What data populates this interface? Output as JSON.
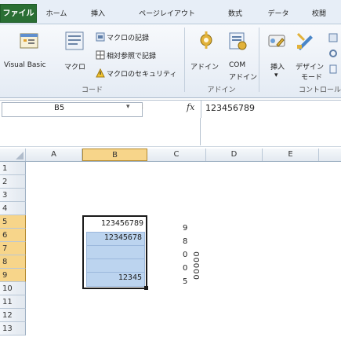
{
  "ribbon": {
    "tabs": [
      "ファイル",
      "ホーム",
      "挿入",
      "ページレイアウト",
      "数式",
      "データ",
      "校閲"
    ],
    "groups": {
      "code": {
        "label": "コード",
        "visual_basic": "Visual Basic",
        "macro": "マクロ",
        "record_macro": "マクロの記録",
        "relative_ref": "相対参照で記録",
        "macro_security": "マクロのセキュリティ"
      },
      "addins": {
        "label": "アドイン",
        "addin": "アドイン",
        "com_line1": "COM",
        "com_line2": "アドイン"
      },
      "controls": {
        "label": "コントロール",
        "insert": "挿入",
        "design_line1": "デザイン",
        "design_line2": "モード"
      }
    }
  },
  "formula_bar": {
    "name_box": "B5",
    "fx": "fx",
    "value": "123456789"
  },
  "columns": [
    "A",
    "B",
    "C",
    "D",
    "E"
  ],
  "rows": [
    "1",
    "2",
    "3",
    "4",
    "5",
    "6",
    "7",
    "8",
    "9",
    "10",
    "11",
    "12",
    "13"
  ],
  "cells": {
    "b5": "123456789",
    "b6": "12345678",
    "b9": "12345",
    "e5": "9",
    "e6": "8",
    "e7": "0",
    "e8": "0",
    "e9": "5",
    "rotated": "00000"
  },
  "colors": {
    "file_tab": "#2a6f34",
    "selection": "#1a1a1a",
    "header_highlight": "#f7d58a",
    "cell_fill": "#bcd4ef"
  }
}
